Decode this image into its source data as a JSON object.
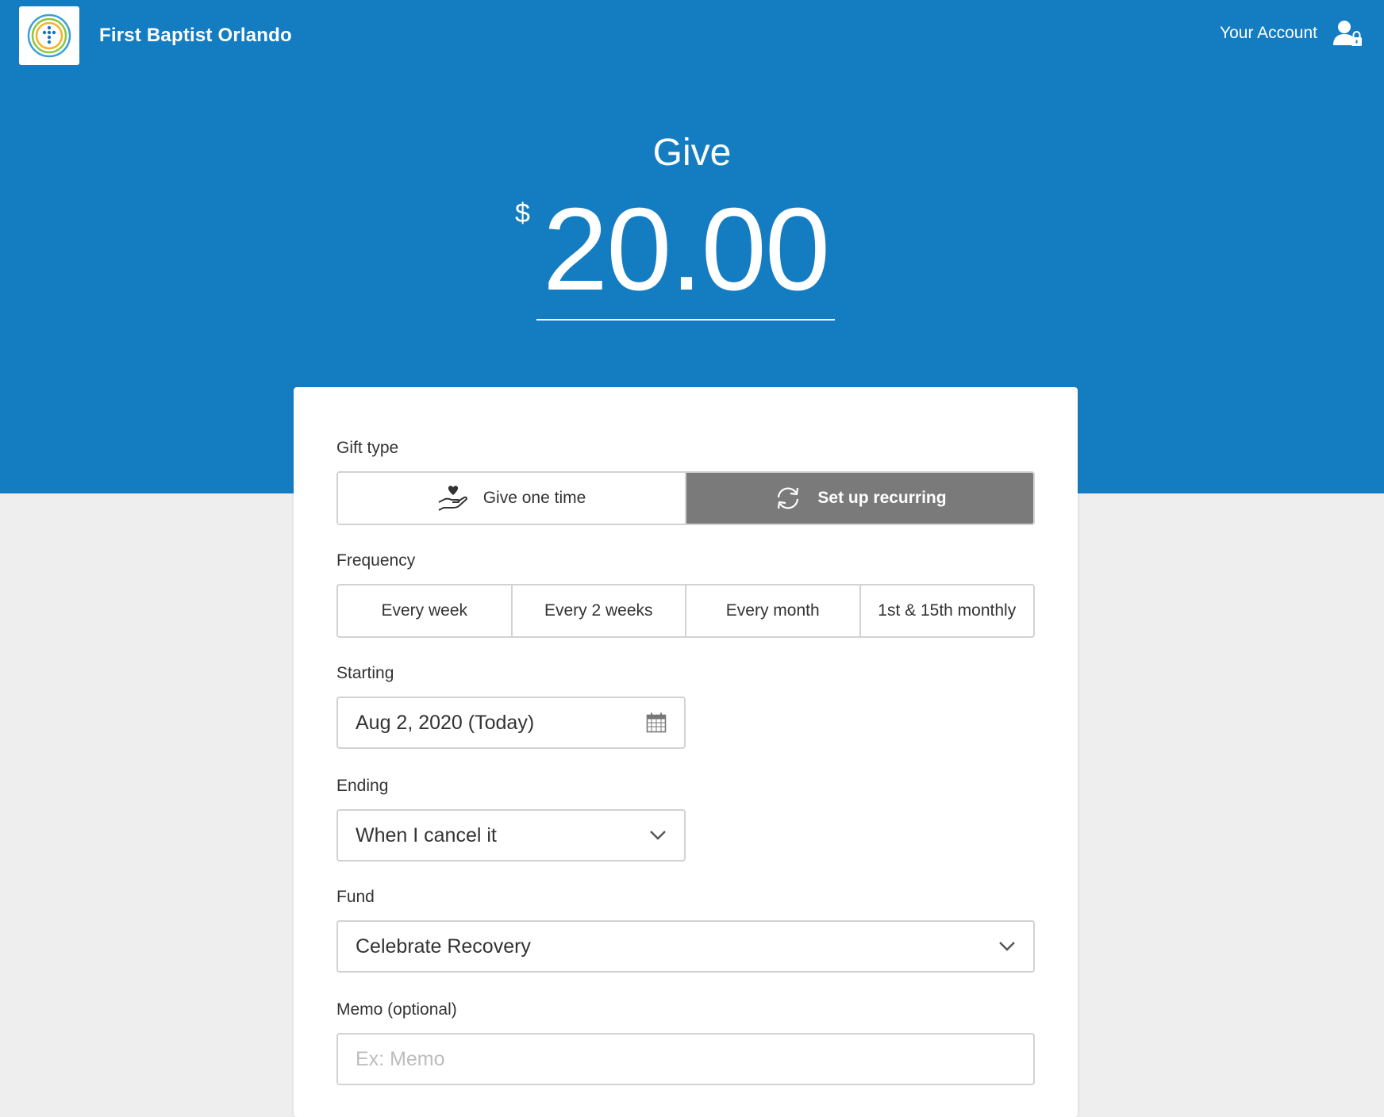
{
  "header": {
    "org_name": "First Baptist Orlando",
    "account_label": "Your Account"
  },
  "hero": {
    "title": "Give",
    "currency_symbol": "$",
    "amount": "20.00"
  },
  "form": {
    "gift_type": {
      "label": "Gift type",
      "options": [
        "Give one time",
        "Set up recurring"
      ],
      "selected": "Set up recurring"
    },
    "frequency": {
      "label": "Frequency",
      "options": [
        "Every week",
        "Every 2 weeks",
        "Every month",
        "1st & 15th monthly"
      ]
    },
    "starting": {
      "label": "Starting",
      "value": "Aug 2, 2020 (Today)"
    },
    "ending": {
      "label": "Ending",
      "value": "When I cancel it"
    },
    "fund": {
      "label": "Fund",
      "value": "Celebrate Recovery"
    },
    "memo": {
      "label": "Memo (optional)",
      "placeholder": "Ex: Memo"
    }
  },
  "colors": {
    "brand_blue": "#147dc2",
    "selected_segment": "#7a7a7a",
    "page_background": "#eeeeee"
  },
  "icons": {
    "logo": "cross-circles-logo",
    "account": "user-lock-icon",
    "one_time": "hand-heart-icon",
    "recurring": "refresh-icon",
    "calendar": "calendar-icon",
    "dropdown": "chevron-down-icon"
  }
}
